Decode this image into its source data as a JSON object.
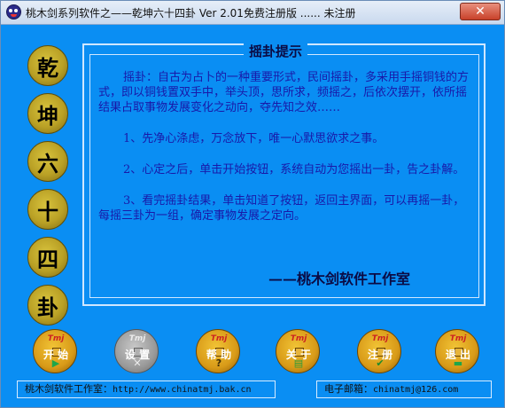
{
  "window": {
    "title": "桃木剑系列软件之——乾坤六十四卦 Ver 2.01免费注册版  ......  未注册",
    "close_label": "✕"
  },
  "side_chars": [
    "乾",
    "坤",
    "六",
    "十",
    "四",
    "卦"
  ],
  "panel": {
    "title": "摇卦提示",
    "intro": "摇卦：自古为占卜的一种重要形式，民间摇卦，多采用手摇铜钱的方式，即以铜钱置双手中，举头顶，思所求，频摇之，后依次摆开，依所摇结果占取事物发展变化之动向，夺先知之效……",
    "items": [
      "1、先净心涤虑，万念放下，唯一心默思欲求之事。",
      "2、心定之后，单击开始按钮，系统自动为您摇出一卦，告之卦解。",
      "3、看完摇卦结果，单击知道了按钮，返回主界面，可以再摇一卦，每摇三卦为一组，确定事物发展之定向。"
    ],
    "signature": "——桃木剑软件工作室"
  },
  "buttons": [
    {
      "label": "开 始",
      "logo": "Tmj",
      "glyph": "▶",
      "glyph_color": "#1ea64a",
      "enabled": true
    },
    {
      "label": "设 置",
      "logo": "Tmj",
      "glyph": "✕",
      "glyph_color": "#eeeeee",
      "enabled": false
    },
    {
      "label": "帮 助",
      "logo": "Tmj",
      "glyph": "?",
      "glyph_color": "#3b2a06",
      "enabled": true
    },
    {
      "label": "关 于",
      "logo": "Tmj",
      "glyph": "▤",
      "glyph_color": "#2a9a3a",
      "enabled": true
    },
    {
      "label": "注 册",
      "logo": "Tmj",
      "glyph": "✔",
      "glyph_color": "#1f8a2a",
      "enabled": true
    },
    {
      "label": "退 出",
      "logo": "Tmj",
      "glyph": "▬",
      "glyph_color": "#1ea64a",
      "enabled": true
    }
  ],
  "status": {
    "left_label": "桃木剑软件工作室：",
    "left_url": "http://www.chinatmj.bak.cn",
    "right_label": "电子邮箱：",
    "right_email": "chinatmj@126.com"
  }
}
